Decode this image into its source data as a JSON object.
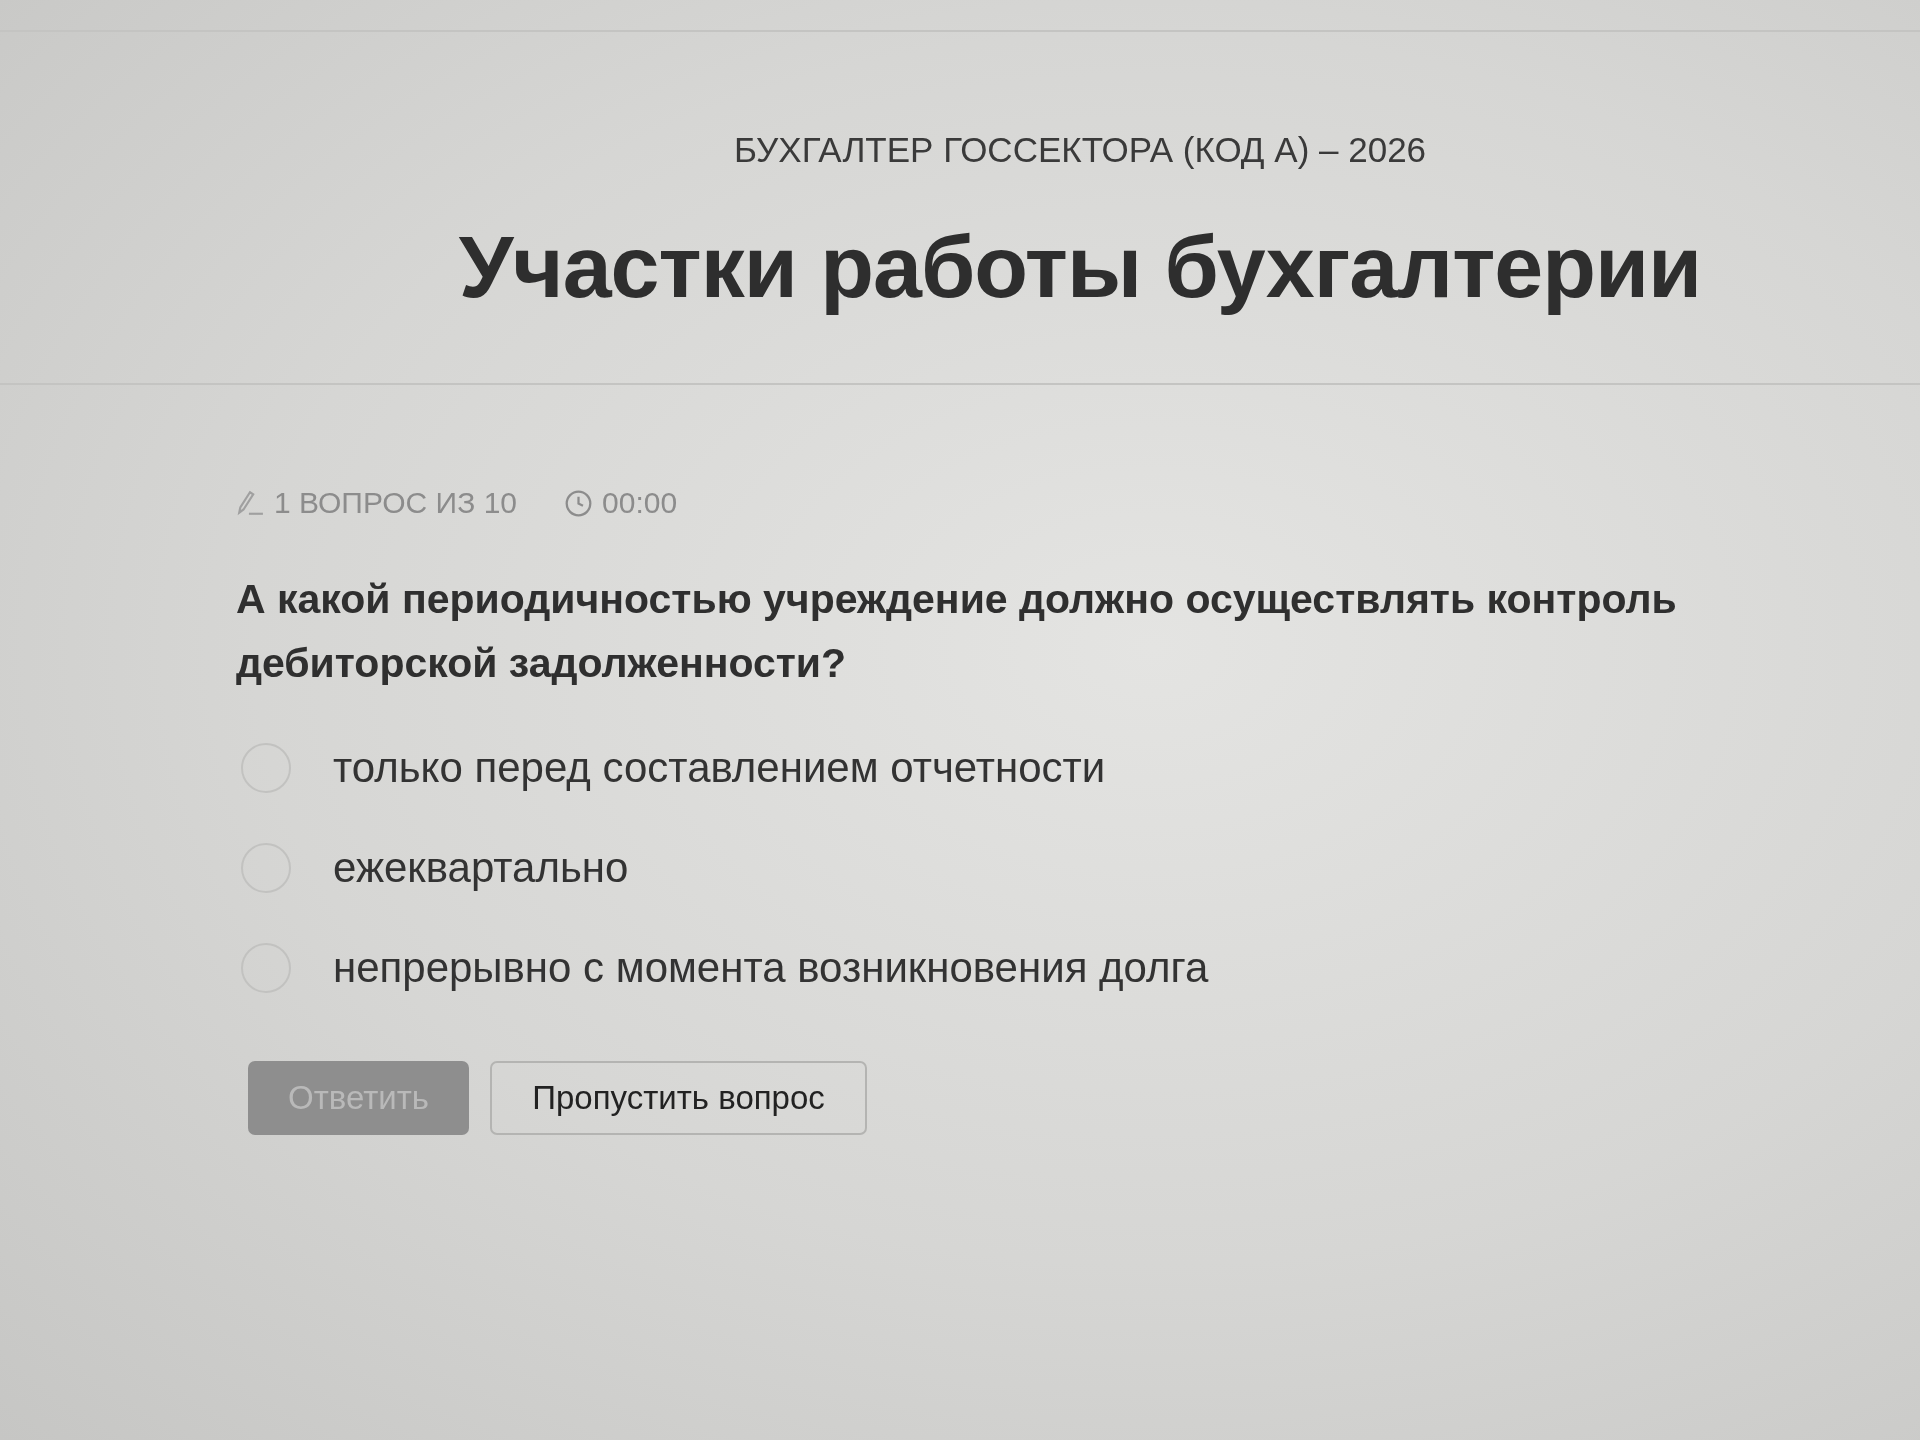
{
  "header": {
    "course": "БУХГАЛТЕР ГОССЕКТОРА (КОД А) – 2026",
    "title": "Участки работы бухгалтерии"
  },
  "quiz": {
    "progress": "1 ВОПРОС ИЗ 10",
    "timer": "00:00",
    "question": "А какой периодичностью учреждение должно осуществлять контроль дебиторской задолженности?",
    "options": [
      {
        "label": "только перед составлением отчетности",
        "selected": false
      },
      {
        "label": "ежеквартально",
        "selected": false
      },
      {
        "label": "непрерывно с момента возникновения долга",
        "selected": false
      }
    ],
    "buttons": [
      {
        "label": "Ответить",
        "kind": "primary",
        "disabled": true
      },
      {
        "label": "Пропустить вопрос",
        "kind": "secondary",
        "disabled": false
      }
    ]
  }
}
